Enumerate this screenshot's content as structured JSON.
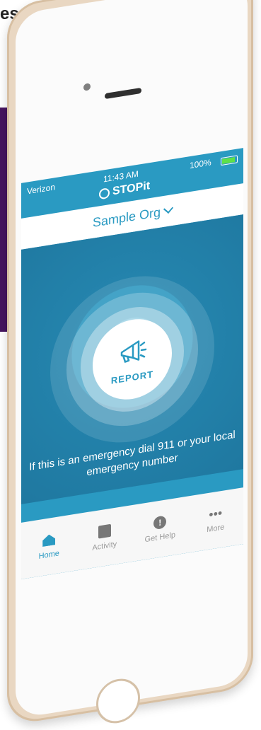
{
  "hero": {
    "headline": "es you time."
  },
  "phone": {
    "statusbar": {
      "carrier": "Verizon",
      "time": "11:43 AM",
      "battery": "100%"
    },
    "brand": "STOPit",
    "org": {
      "name": "Sample Org"
    },
    "main": {
      "report_label": "REPORT",
      "emergency_text": "If this is an emergency dial 911 or your local emergency number"
    },
    "tabbar": {
      "items": [
        {
          "label": "Home",
          "icon": "home-icon",
          "active": true
        },
        {
          "label": "Activity",
          "icon": "activity-icon",
          "active": false
        },
        {
          "label": "Get Help",
          "icon": "help-icon",
          "active": false
        },
        {
          "label": "More",
          "icon": "more-icon",
          "active": false
        }
      ]
    }
  },
  "colors": {
    "primary": "#2a9ac2",
    "purple_panel": "#46145f",
    "battery": "#5ee049",
    "phone_gold": "#e9d7c2"
  }
}
